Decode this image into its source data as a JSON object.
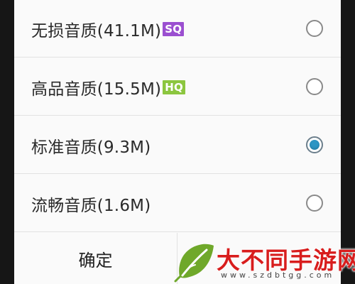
{
  "dialog": {
    "options": [
      {
        "label": "无损音质(41.1M)",
        "badge": "SQ",
        "badge_color": "#9b4fd0",
        "selected": false
      },
      {
        "label": "高品音质(15.5M)",
        "badge": "HQ",
        "badge_color": "#8cc63f",
        "selected": false
      },
      {
        "label": "标准音质(9.3M)",
        "badge": "",
        "selected": true
      },
      {
        "label": "流畅音质(1.6M)",
        "badge": "",
        "selected": false
      }
    ],
    "confirm_label": "确定",
    "accent_color": "#2b95c4"
  },
  "watermark": {
    "title": "大不同手游网",
    "url": "www.szdbtgg.com",
    "leaf_icon": "leaf-icon"
  }
}
